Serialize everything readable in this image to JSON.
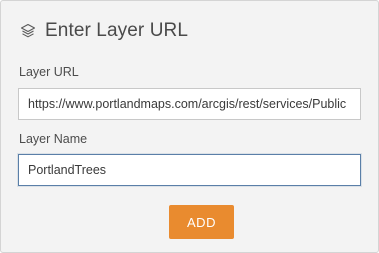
{
  "header": {
    "icon": "layers-icon",
    "title": "Enter Layer URL"
  },
  "form": {
    "layer_url": {
      "label": "Layer URL",
      "value": "https://www.portlandmaps.com/arcgis/rest/services/Public"
    },
    "layer_name": {
      "label": "Layer Name",
      "value": "PortlandTrees"
    },
    "add_label": "ADD"
  },
  "colors": {
    "panel_background": "#f3f3f3",
    "accent": "#e98b2f",
    "focus_border": "#5a7fa8"
  }
}
